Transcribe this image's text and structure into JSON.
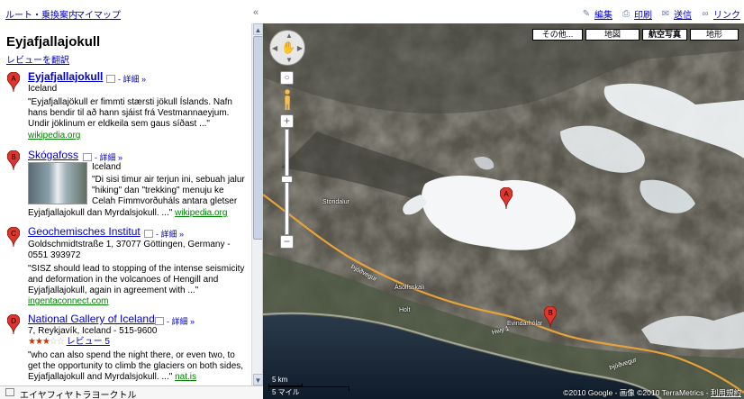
{
  "top_nav": {
    "route_label": "ルート・乗換案内",
    "mymaps_label": "マイマップ",
    "collapse_glyph": "«"
  },
  "top_links": [
    {
      "label": "編集",
      "icon": "edit-icon"
    },
    {
      "label": "印刷",
      "icon": "print-icon"
    },
    {
      "label": "送信",
      "icon": "mail-icon"
    },
    {
      "label": "リンク",
      "icon": "link-icon"
    }
  ],
  "panel": {
    "title": "Eyjafjallajokull",
    "translate_label": "レビューを翻訳",
    "results": [
      {
        "marker": "A",
        "title": "Eyjafjallajokull",
        "details": "- 詳細 »",
        "line1": "Iceland",
        "snippet": [
          "\"Eyjafjallajökull er fimmti stærsti jökull Íslands. Nafn",
          "hans bendir til að hann sjáist frá Vestmannaeyjum.",
          "Undir jöklinum er eldkeila sem gaus síðast ...\""
        ],
        "source": "wikipedia.org"
      },
      {
        "marker": "B",
        "title": "Skógafoss",
        "details": "- 詳細 »",
        "line1": "Iceland",
        "snippet": [
          "\"Di sisi timur air terjun ini, sebuah jalur",
          "\"hiking\" dan \"trekking\" menuju ke",
          "Celah Fimmvorðuháls antara gletser",
          "Eyjafjallajokull dan Myrdalsjokull. ...\""
        ],
        "source": "wikipedia.org"
      },
      {
        "marker": "C",
        "title": "Geochemisches Institut",
        "details": "- 詳細 »",
        "line1": "Goldschmidtstraße 1, 37077 Göttingen, Germany -",
        "line2": "0551 393972",
        "snippet": [
          "\"SISZ should lead to stopping of the intense seismicity",
          "and deformation in the volcanoes of Hengill and",
          "Eyjafjallajokull, again in agreement with ...\""
        ],
        "source": "ingentaconnect.com"
      },
      {
        "marker": "D",
        "title": "National Gallery of Iceland",
        "details": "- 詳細 »",
        "line1": "7, Reykjavík, Iceland - 515-9600",
        "rating": 3,
        "rating_max": 5,
        "reviews": "レビュー 5",
        "snippet": [
          "\"who can also spend the night there, or even two, to",
          "get the opportunity to climb the glaciers on both sides,",
          "Eyjafjallajokull and Myrdalsjokull. ...\""
        ],
        "source": "nat.is"
      }
    ],
    "bottom_label": "エイヤフィヤトラヨークトル"
  },
  "map": {
    "types": [
      "その他...",
      "地図",
      "航空写真",
      "地形"
    ],
    "selected_type": "航空写真",
    "labels": {
      "storidalur": "Stóridalur",
      "asolfsskali": "Ásólfsskáli",
      "holt": "Holt",
      "evindarholar": "Evindarhólar",
      "road1": "Þjóðvegur",
      "road2": "Hwy 1",
      "road3": "Þjóðvegur"
    },
    "markers": [
      "A",
      "B"
    ],
    "scale": {
      "km": "5 km",
      "mile": "5 マイル"
    },
    "copyright": "©2010 Google - 画像 ©2010 TerraMetrics -",
    "terms": "利用規約"
  },
  "colors": {
    "link": "#0000cc",
    "source_green": "#008000",
    "marker_red": "#e0352d"
  }
}
